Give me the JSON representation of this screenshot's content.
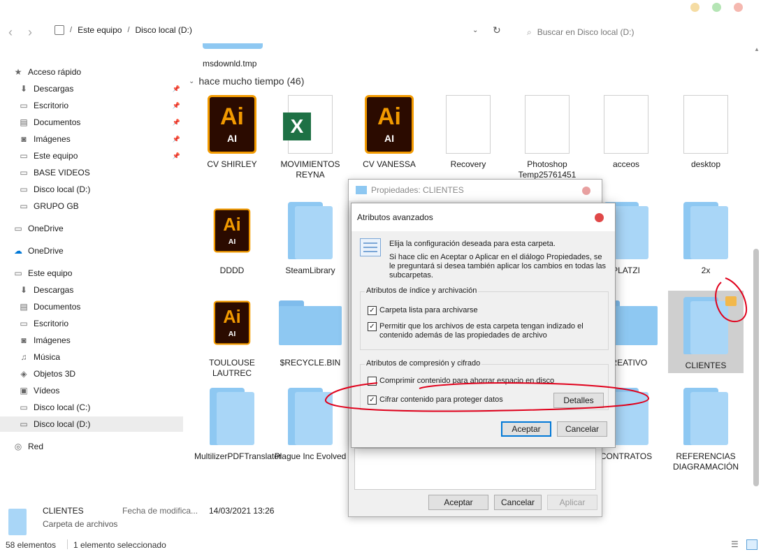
{
  "colors": {
    "accent": "#0078d7",
    "annotation": "#e0001b",
    "folder": "#8ec8f2",
    "dot_yellow": "#f5dca3",
    "dot_green": "#b5e5b5",
    "dot_red": "#f5b8b0"
  },
  "address": {
    "crumbs": [
      "Este equipo",
      "Disco local (D:)"
    ],
    "search_placeholder": "Buscar en Disco local (D:)"
  },
  "sidebar": {
    "items": [
      {
        "label": "Acceso rápido",
        "icon": "star-icon",
        "group": true
      },
      {
        "label": "Descargas",
        "icon": "download-icon",
        "pinned": true
      },
      {
        "label": "Escritorio",
        "icon": "desktop-icon",
        "pinned": true
      },
      {
        "label": "Documentos",
        "icon": "documents-icon",
        "pinned": true
      },
      {
        "label": "Imágenes",
        "icon": "camera-icon",
        "pinned": true
      },
      {
        "label": "Este equipo",
        "icon": "monitor-icon",
        "pinned": true
      },
      {
        "label": "BASE VIDEOS",
        "icon": "folder-icon"
      },
      {
        "label": "Disco local (D:)",
        "icon": "drive-icon"
      },
      {
        "label": "GRUPO GB",
        "icon": "folder-icon"
      },
      {
        "label": "OneDrive",
        "icon": "folder-icon",
        "group": true
      },
      {
        "label": "OneDrive",
        "icon": "cloud-icon",
        "group": true
      },
      {
        "label": "Este equipo",
        "icon": "monitor-icon",
        "group": true
      },
      {
        "label": "Descargas",
        "icon": "download-icon"
      },
      {
        "label": "Documentos",
        "icon": "documents-icon"
      },
      {
        "label": "Escritorio",
        "icon": "desktop-icon"
      },
      {
        "label": "Imágenes",
        "icon": "camera-icon"
      },
      {
        "label": "Música",
        "icon": "music-icon"
      },
      {
        "label": "Objetos 3D",
        "icon": "cube-icon"
      },
      {
        "label": "Vídeos",
        "icon": "video-icon"
      },
      {
        "label": "Disco local (C:)",
        "icon": "drive-icon"
      },
      {
        "label": "Disco local (D:)",
        "icon": "drive-icon",
        "selected": true
      },
      {
        "label": "Red",
        "icon": "network-icon",
        "group": true
      }
    ]
  },
  "main": {
    "top_file": "msdownld.tmp",
    "group_header": "hace mucho tiempo (46)",
    "files": [
      {
        "name": "CV SHIRLEY",
        "type": "ai"
      },
      {
        "name": "MOVIMIENTOS REYNA",
        "type": "xls"
      },
      {
        "name": "CV VANESSA",
        "type": "ai"
      },
      {
        "name": "Recovery",
        "type": "doc"
      },
      {
        "name": "Photoshop Temp25761451",
        "type": "doc"
      },
      {
        "name": "acceos",
        "type": "doc"
      },
      {
        "name": "desktop",
        "type": "doc"
      },
      {
        "name": "DDDD",
        "type": "folder-ai"
      },
      {
        "name": "SteamLibrary",
        "type": "folder"
      },
      {
        "name": "PLATZI",
        "type": "folder"
      },
      {
        "name": "2x",
        "type": "folder"
      },
      {
        "name": "TOULOUSE LAUTREC",
        "type": "folder-ai"
      },
      {
        "name": "$RECYCLE.BIN",
        "type": "folder-flat"
      },
      {
        "name": "CREATIVO",
        "type": "folder-flat"
      },
      {
        "name": "CLIENTES",
        "type": "folder",
        "selected": true
      },
      {
        "name": "MultilizerPDFTranslator",
        "type": "folder"
      },
      {
        "name": "Plague Inc Evolved",
        "type": "folder"
      },
      {
        "name": "CONTRATOS",
        "type": "folder"
      },
      {
        "name": "REFERENCIAS DIAGRAMACIÓN",
        "type": "folder"
      }
    ]
  },
  "details": {
    "name": "CLIENTES",
    "type": "Carpeta de archivos",
    "date_label": "Fecha de modifica...",
    "date_value": "14/03/2021 13:26"
  },
  "status": {
    "count": "58 elementos",
    "selected": "1 elemento seleccionado"
  },
  "props_dialog": {
    "title": "Propiedades: CLIENTES",
    "ok": "Aceptar",
    "cancel": "Cancelar",
    "apply": "Aplicar"
  },
  "adv_dialog": {
    "title": "Atributos avanzados",
    "desc1": "Elija la configuración deseada para esta carpeta.",
    "desc2": "Si hace clic en Aceptar o Aplicar en el diálogo Propiedades, se le preguntará si desea también aplicar los cambios en todas las subcarpetas.",
    "group1_legend": "Atributos de índice y archivación",
    "chk_archive": "Carpeta lista para archivarse",
    "chk_index": "Permitir que los archivos de esta carpeta tengan indizado el contenido además de las propiedades de archivo",
    "group2_legend": "Atributos de compresión y cifrado",
    "chk_compress": "Comprimir contenido para ahorrar espacio en disco",
    "chk_encrypt": "Cifrar contenido para proteger datos",
    "details_btn": "Detalles",
    "ok": "Aceptar",
    "cancel": "Cancelar",
    "states": {
      "archive": true,
      "index": true,
      "compress": false,
      "encrypt": true
    }
  }
}
